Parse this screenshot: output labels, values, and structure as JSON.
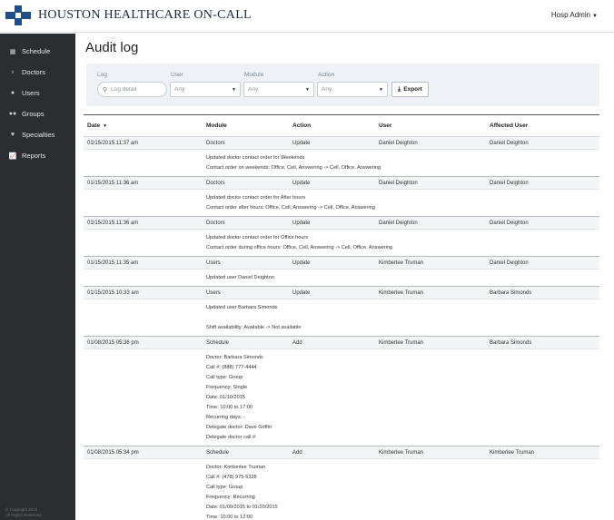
{
  "header": {
    "logo_text": "HOUSTON HEALTHCARE ON-CALL",
    "user_menu": "Hosp Admin"
  },
  "sidebar": {
    "items": [
      {
        "label": "Schedule",
        "icon": "calendar-icon",
        "glyph": "▦"
      },
      {
        "label": "Doctors",
        "icon": "stethoscope-icon",
        "glyph": "♁"
      },
      {
        "label": "Users",
        "icon": "user-icon",
        "glyph": "●"
      },
      {
        "label": "Groups",
        "icon": "group-icon",
        "glyph": "●●"
      },
      {
        "label": "Specialties",
        "icon": "heart-icon",
        "glyph": "♥"
      },
      {
        "label": "Reports",
        "icon": "line-chart-icon",
        "glyph": "📈"
      }
    ],
    "copyright": [
      "© Copyright 2015",
      "All Rights Reserved"
    ]
  },
  "page": {
    "title": "Audit log"
  },
  "filters": {
    "log_label": "Log",
    "log_placeholder": "Log detail",
    "user_label": "User",
    "user_value": "Any",
    "module_label": "Module",
    "module_value": "Any",
    "action_label": "Action",
    "action_value": "Any",
    "export_label": "Export"
  },
  "table": {
    "headers": {
      "date": "Date",
      "module": "Module",
      "action": "Action",
      "user": "User",
      "affected": "Affected User"
    },
    "rows": [
      {
        "date": "01/15/2015 11:37 am",
        "module": "Doctors",
        "action": "Update",
        "user": "Daniel Deighton",
        "affected": "Daniel Deighton",
        "details": [
          "Updated doctor contact order for Weekends",
          "Contact order on weekends: Office, Cell, Answering -> Cell, Office, Answering"
        ]
      },
      {
        "date": "01/15/2015 11:36 am",
        "module": "Doctors",
        "action": "Update",
        "user": "Daniel Deighton",
        "affected": "Daniel Deighton",
        "details": [
          "Updated doctor contact order for After hours",
          "Contact order after hours: Office, Cell, Answering -> Cell, Office, Answering"
        ]
      },
      {
        "date": "01/15/2015 11:36 am",
        "module": "Doctors",
        "action": "Update",
        "user": "Daniel Deighton",
        "affected": "Daniel Deighton",
        "details": [
          "Updated doctor contact order for Office hours",
          "Contact order during office hours: Office, Cell, Answering -> Cell, Office, Answering"
        ]
      },
      {
        "date": "01/15/2015 11:35 am",
        "module": "Users",
        "action": "Update",
        "user": "Kimberlee Truman",
        "affected": "Daniel Deighton",
        "details": [
          "Updated user Daniel Deighton"
        ]
      },
      {
        "date": "01/15/2015 10:33 am",
        "module": "Users",
        "action": "Update",
        "user": "Kimberlee Truman",
        "affected": "Barbara Simonds",
        "details": [
          "Updated user Barbara Simonds",
          "",
          "Shift availability: Available -> Not available"
        ]
      },
      {
        "date": "01/08/2015 05:36 pm",
        "module": "Schedule",
        "action": "Add",
        "user": "Kimberlee Truman",
        "affected": "Barbara Simonds",
        "details": [
          "Doctor: Barbara Simonds",
          "Call #: (888) 777-4444",
          "Call type: Group",
          "Frequency: Single",
          "Date: 01/10/2015",
          "Time: 10:00 to 17:00",
          "Recurring days: -",
          "Delegate doctor: Dave Griffin",
          "Delegate doctor call #:"
        ]
      },
      {
        "date": "01/08/2015 05:34 pm",
        "module": "Schedule",
        "action": "Add",
        "user": "Kimberlee Truman",
        "affected": "Kimberlee Truman",
        "details": [
          "Doctor: Kimberlee Truman",
          "Call #: (478) 975-5328",
          "Call type: Group",
          "Frequency: Recurring",
          "Date: 01/09/2015 to 01/20/2015",
          "Time: 10:00 to 12:00"
        ]
      }
    ]
  },
  "colors": {
    "sidebar_bg": "#2b2e30",
    "brand_blue": "#1f4e8c",
    "filter_bg": "#eef2f6"
  }
}
